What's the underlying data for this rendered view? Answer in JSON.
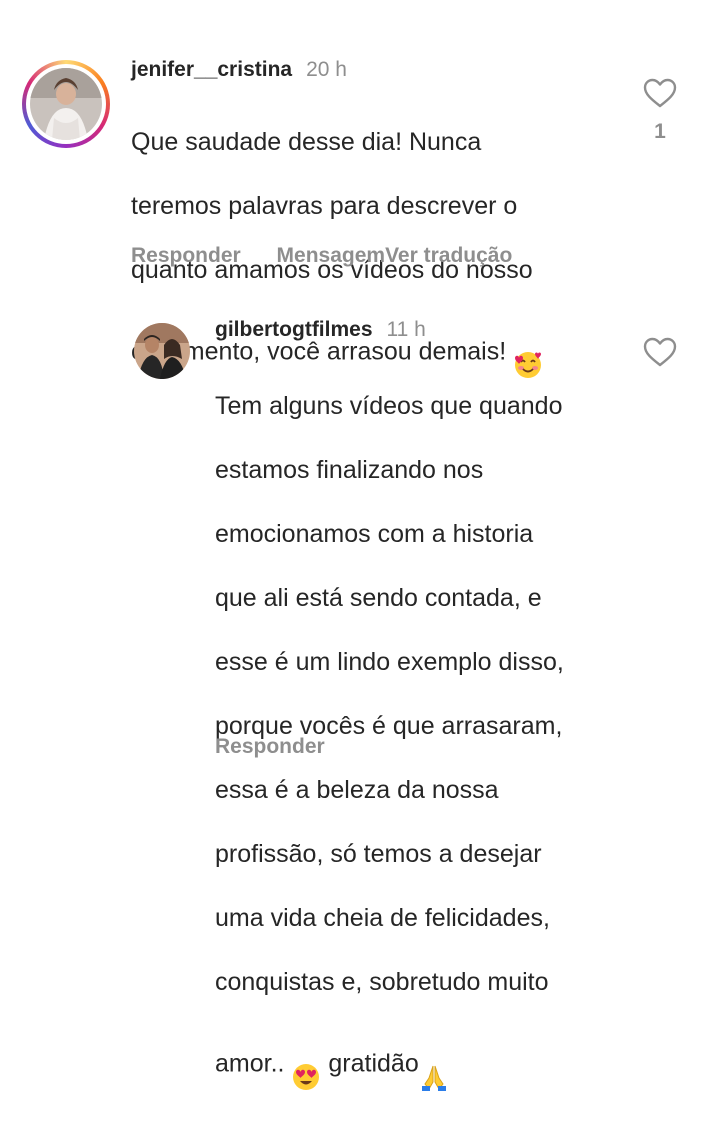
{
  "comments": [
    {
      "username": "jenifer__cristina",
      "time": "20 h",
      "text_lines": [
        "Que saudade desse dia! Nunca",
        "teremos palavras para descrever o",
        "quanto amamos os vídeos do nosso",
        "casamento, você arrasou demais!"
      ],
      "emoji_end": "smiling-face-with-hearts",
      "actions": {
        "reply": "Responder",
        "message": "Mensagem",
        "translate": "Ver tradução"
      },
      "likes": "1"
    },
    {
      "username": "gilbertogtfilmes",
      "time": "11 h",
      "text_lines": [
        "Tem alguns vídeos que quando",
        "estamos finalizando nos",
        "emocionamos com a historia",
        "que ali está sendo contada, e",
        "esse é um lindo exemplo disso,",
        "porque vocês é que arrasaram,",
        "essa é a beleza da nossa",
        "profissão, só temos a desejar",
        "uma vida cheia de felicidades,",
        "conquistas e, sobretudo muito"
      ],
      "last_line": {
        "before": "amor..",
        "after": "gratidão"
      },
      "emojis": [
        "heart-eyes-emoji",
        "praying-hands-emoji"
      ],
      "actions": {
        "reply": "Responder"
      }
    }
  ],
  "colors": {
    "text": "#262626",
    "secondary": "#8e8e8e",
    "heart_outline": "#262626"
  }
}
